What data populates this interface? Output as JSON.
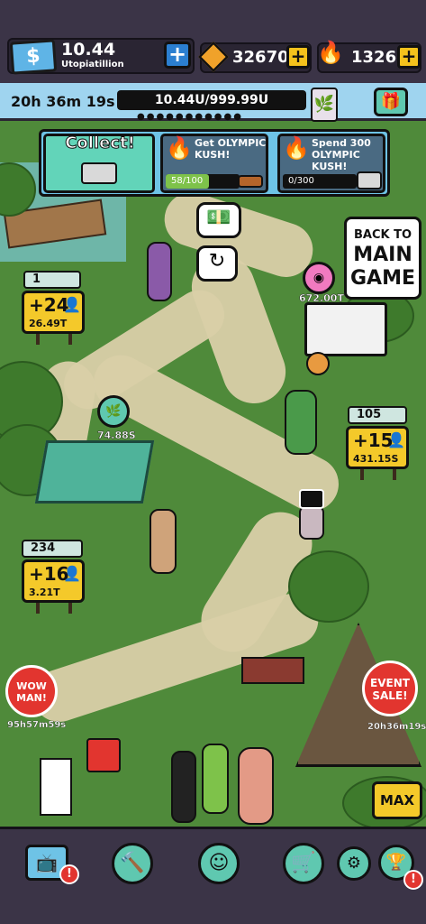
{
  "topbar": {
    "money": "10.44",
    "money_unit": "Utopiatillion",
    "gems": "32670",
    "fire": "1326",
    "bill_symbol": "$",
    "plus": "+"
  },
  "timer": {
    "countdown": "20h 36m 19s",
    "progress": "10.44U/999.99U",
    "dots": "●●●●●●●●●●●"
  },
  "quest": {
    "collect_label": "Collect!",
    "task1": {
      "title": "Get OLYMPIC KUSH!",
      "progress": "58/100",
      "fraction": 0.58
    },
    "task2": {
      "title": "Spend 300 OLYMPIC KUSH!",
      "progress": "0/300",
      "fraction": 0
    }
  },
  "back_button": {
    "line1": "BACK TO",
    "line2": "MAIN",
    "line3": "GAME"
  },
  "stations": [
    {
      "count": "1",
      "rate": "+24",
      "value": "26.49T"
    },
    {
      "count": "105",
      "rate": "+15",
      "value": "431.15S"
    },
    {
      "count": "234",
      "rate": "+16",
      "value": "3.21T"
    }
  ],
  "orbs": [
    {
      "value": "672.00T",
      "color": "#f07ac0"
    },
    {
      "value": "74.88S",
      "color": "#5fc8b0"
    }
  ],
  "badges": {
    "wow": "WOW MAN!",
    "wow_timer": "95h57m59s",
    "event": "EVENT SALE!",
    "event_timer": "20h36m19s"
  },
  "max_label": "MAX",
  "nav": {
    "alert": "!",
    "icons": [
      "tv-icon",
      "hammer-icon",
      "character-icon",
      "cart-icon",
      "gear-icon",
      "trophy-icon"
    ]
  },
  "colors": {
    "grass": "#4f8a3a",
    "path": "#d9cfa8",
    "topbar": "#3b3447",
    "accent_teal": "#5fc8b0",
    "sign_yellow": "#f4c92a",
    "alert_red": "#e2352f"
  }
}
